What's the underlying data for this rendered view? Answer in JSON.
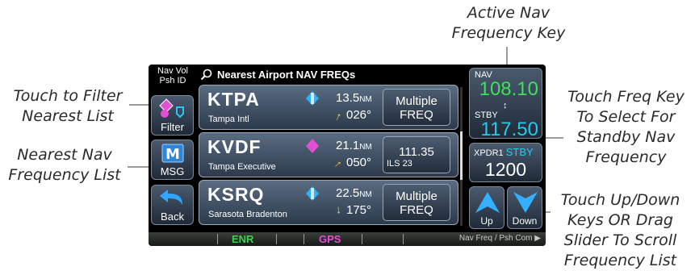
{
  "callouts": {
    "active_nav_freq": [
      "Active Nav",
      "Frequency Key"
    ],
    "filter": [
      "Touch to Filter",
      "Nearest List"
    ],
    "nearest_list": [
      "Nearest Nav",
      "Frequency List"
    ],
    "select_freq": [
      "Touch Freq Key",
      "To Select For",
      "Standby Nav",
      "Frequency"
    ],
    "scroll": [
      "Touch Up/Down",
      "Keys OR Drag",
      "Slider To Scroll",
      "Frequency List"
    ]
  },
  "screen": {
    "navvol_label": [
      "Nav Vol",
      "Psh ID"
    ],
    "title": "Nearest Airport NAV FREQs",
    "left_buttons": {
      "filter": "Filter",
      "msg": "MSG",
      "back": "Back"
    },
    "airports": [
      {
        "id": "KTPA",
        "name": "Tampa Intl",
        "dist": "13.5",
        "dist_unit": "NM",
        "bearing": "026°",
        "freq": [
          "Multiple",
          "FREQ"
        ]
      },
      {
        "id": "KVDF",
        "name": "Tampa Executive",
        "dist": "21.1",
        "dist_unit": "NM",
        "bearing": "050°",
        "freq": [
          "111.35",
          "ILS 23"
        ]
      },
      {
        "id": "KSRQ",
        "name": "Sarasota Bradenton",
        "dist": "22.5",
        "dist_unit": "NM",
        "bearing": "175°",
        "freq": [
          "Multiple",
          "FREQ"
        ]
      }
    ],
    "nav": {
      "label": "NAV",
      "active": "108.10",
      "stby_label": "STBY",
      "standby": "117.50"
    },
    "xpdr": {
      "label": "XPDR1",
      "mode": "STBY",
      "code": "1200"
    },
    "scroll": {
      "up": "Up",
      "down": "Down"
    },
    "bottom": {
      "enr": "ENR",
      "gps": "GPS",
      "right": "Nav Freq / Psh Com"
    }
  },
  "colors": {
    "nav_active": "#3ee05a",
    "standby": "#29c8ef",
    "enr": "#3ed04e",
    "gps": "#e24fd3",
    "airport_icon_towered": "#29b3ff",
    "airport_icon_untowered": "#e24fd3"
  }
}
